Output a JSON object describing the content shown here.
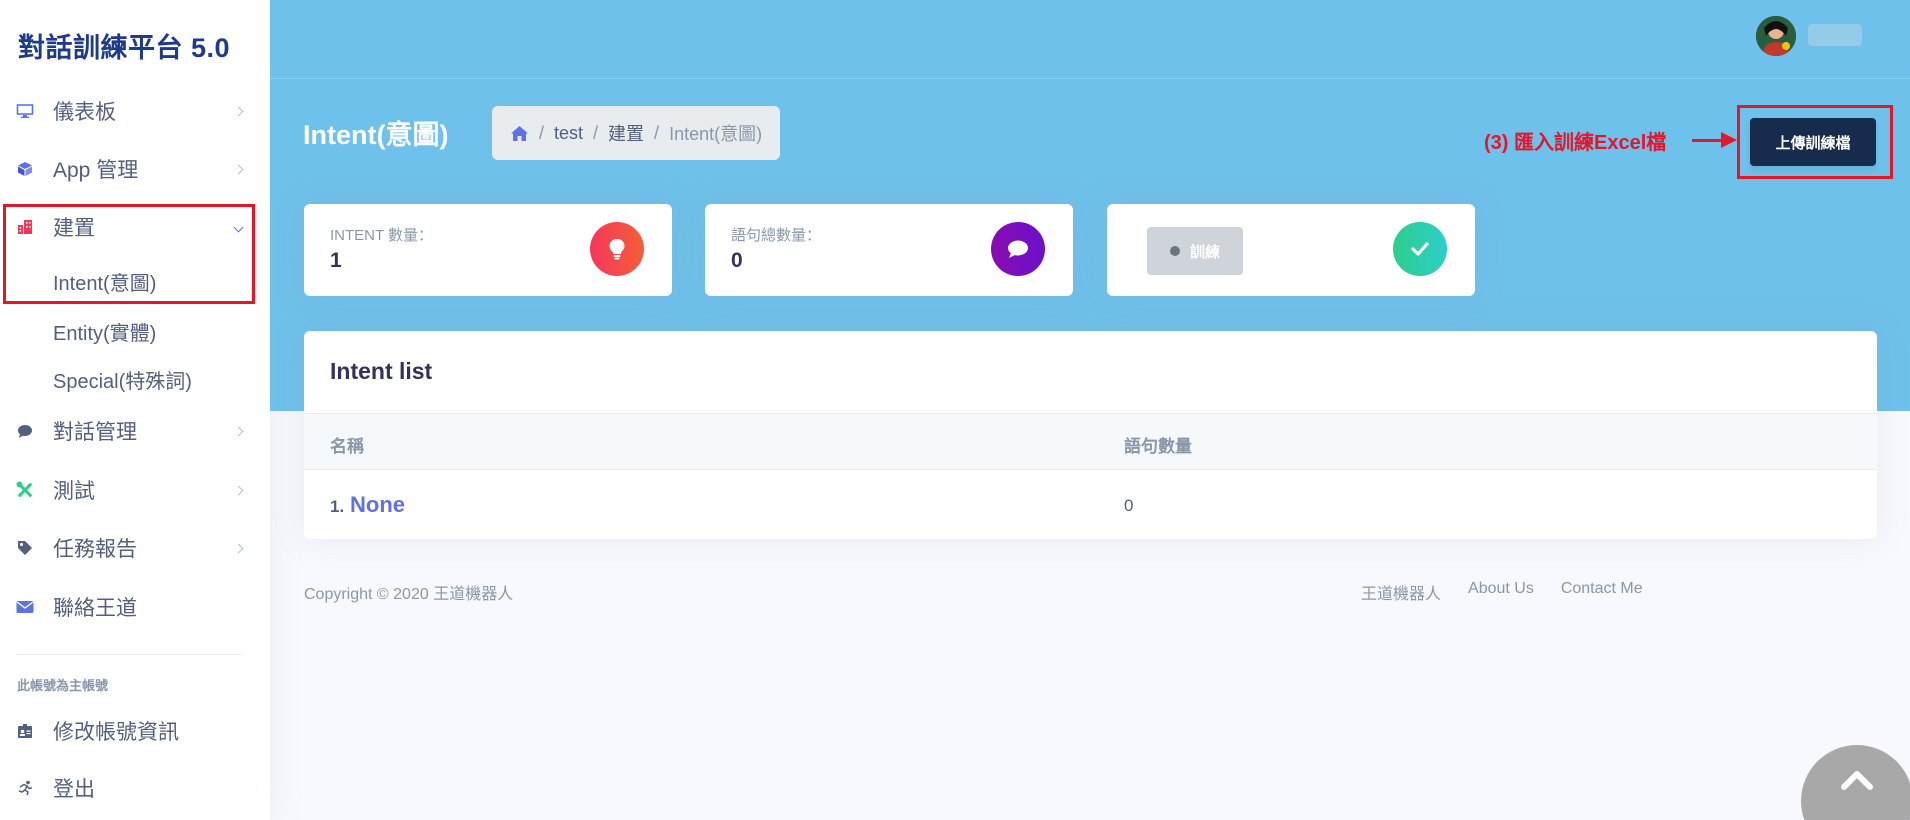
{
  "sidebar": {
    "brand": "對話訓練平台 5.0",
    "items": [
      {
        "label": "儀表板"
      },
      {
        "label": "App 管理"
      },
      {
        "label": "建置"
      },
      {
        "label": "對話管理"
      },
      {
        "label": "測試"
      },
      {
        "label": "任務報告"
      },
      {
        "label": "聯絡王道"
      }
    ],
    "sub_items": [
      {
        "label": "Intent(意圖)"
      },
      {
        "label": "Entity(實體)"
      },
      {
        "label": "Special(特殊詞)"
      }
    ],
    "account_heading": "此帳號為主帳號",
    "account_items": [
      {
        "label": "修改帳號資訊"
      },
      {
        "label": "登出"
      }
    ]
  },
  "header": {
    "page_title": "Intent(意圖)",
    "breadcrumb": [
      "test",
      "建置",
      "Intent(意圖)"
    ],
    "annotation": "(3) 匯入訓練Excel檔",
    "upload_label": "上傳訓練檔"
  },
  "stats": [
    {
      "label": "INTENT 數量：",
      "value": "1",
      "color": "#f5365c"
    },
    {
      "label": "語句總數量：",
      "value": "0",
      "color": "#8a0bb1"
    },
    {
      "train_label": "訓練",
      "color": "#2dce89"
    }
  ],
  "intent_list": {
    "title": "Intent list",
    "columns": [
      "名稱",
      "語句數量"
    ],
    "rows": [
      {
        "index": "1.",
        "name": "None",
        "count": "0"
      }
    ]
  },
  "footer": {
    "copyright": "Copyright © 2020 王道機器人",
    "links": [
      "王道機器人",
      "About Us",
      "Contact Me"
    ]
  },
  "colors": {
    "header_bg": "#6ec1ea",
    "annotation": "#e4162a",
    "primary": "#5e72e4",
    "dark_button": "#172b4d"
  }
}
